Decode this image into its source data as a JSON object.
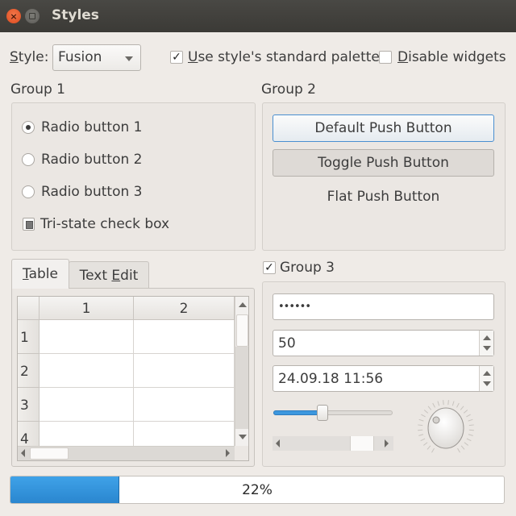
{
  "window": {
    "title": "Styles",
    "close_glyph": "×"
  },
  "top_bar": {
    "style_label_mnemonic": "S",
    "style_label_rest": "tyle:",
    "style_selected": "Fusion",
    "palette_checkbox": {
      "checked": true,
      "mark": "✓",
      "mnemonic": "U",
      "label_rest": "se style's standard palette"
    },
    "disable_checkbox": {
      "checked": false,
      "mnemonic": "D",
      "label_rest": "isable widgets"
    }
  },
  "group1": {
    "title": "Group 1",
    "radios": [
      {
        "label": "Radio button 1",
        "checked": true
      },
      {
        "label": "Radio button 2",
        "checked": false
      },
      {
        "label": "Radio button 3",
        "checked": false
      }
    ],
    "tristate_label": "Tri-state check box",
    "tristate_state": "partial"
  },
  "group2": {
    "title": "Group 2",
    "default_button": "Default Push Button",
    "toggle_button": "Toggle Push Button",
    "flat_button": "Flat Push Button"
  },
  "tabs": {
    "table_mnemonic": "T",
    "table_rest": "able",
    "textedit_prefix": "Text ",
    "textedit_mnemonic": "E",
    "textedit_rest": "dit",
    "active": "Table"
  },
  "table": {
    "columns": [
      "1",
      "2"
    ],
    "rows": [
      "1",
      "2",
      "3",
      "4"
    ]
  },
  "group3": {
    "title": "Group 3",
    "checked": true,
    "check_mark": "✓",
    "password_value": "••••••",
    "spin_value": "50",
    "datetime_value": "24.09.18 11:56",
    "slider_value_fraction": 0.41,
    "scrollbar_value_fraction": 0.72
  },
  "progress": {
    "value": 22,
    "text": "22%",
    "color": "#3195dd"
  }
}
